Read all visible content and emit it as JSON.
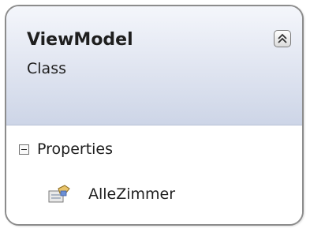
{
  "class_shape": {
    "name": "ViewModel",
    "stereotype": "Class",
    "collapse_icon": "double-chevron-up-icon",
    "compartments": [
      {
        "label": "Properties",
        "toggle_icon": "minus-box-icon",
        "members": [
          {
            "name": "AlleZimmer",
            "icon": "property-icon"
          }
        ]
      }
    ]
  },
  "colors": {
    "border": "#8c8c8c",
    "header_top": "#f4f6fb",
    "header_bottom": "#cdd5e7",
    "text": "#1e1e1e"
  }
}
